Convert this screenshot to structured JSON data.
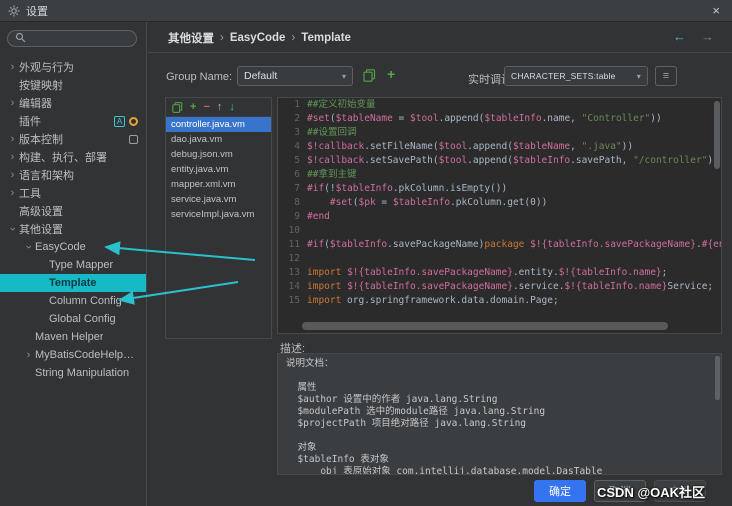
{
  "colors": {
    "accent_cyan": "#2bc0cd",
    "selection_blue": "#3874cb",
    "ok_blue": "#3574f0",
    "template_highlight": "#17b9c6"
  },
  "icons": {
    "close": "×",
    "back_arrow": "←",
    "forward_arrow": "→",
    "chevron": "›",
    "crumb_sep": "›",
    "dropdown_arrow": "▾",
    "add": "+",
    "remove": "−",
    "move_up": "↑",
    "move_down": "↓",
    "console": "≡"
  },
  "window": {
    "title": "设置"
  },
  "sidebar": {
    "items": [
      {
        "id": "appearance-behavior",
        "label": "外观与行为",
        "state": "collapsed",
        "level": 0
      },
      {
        "id": "keymap",
        "label": "按键映射",
        "state": "leaf",
        "level": 0
      },
      {
        "id": "editor",
        "label": "编辑器",
        "state": "collapsed",
        "level": 0
      },
      {
        "id": "plugins",
        "label": "插件",
        "state": "leaf",
        "level": 0,
        "badges": [
          {
            "name": "translation-plugin-icon",
            "glyph": "A",
            "style": "translate"
          },
          {
            "name": "plugin-gear-icon",
            "glyph": "",
            "style": "gear"
          }
        ]
      },
      {
        "id": "version-control",
        "label": "版本控制",
        "state": "collapsed",
        "level": 0,
        "badges": [
          {
            "name": "vcs-plugin-icon",
            "glyph": "",
            "style": "box"
          }
        ]
      },
      {
        "id": "build-execution-deployment",
        "label": "构建、执行、部署",
        "state": "collapsed",
        "level": 0
      },
      {
        "id": "languages-frameworks",
        "label": "语言和架构",
        "state": "collapsed",
        "level": 0
      },
      {
        "id": "tools",
        "label": "工具",
        "state": "collapsed",
        "level": 0
      },
      {
        "id": "advanced-settings",
        "label": "高级设置",
        "state": "leaf",
        "level": 0
      },
      {
        "id": "other-settings",
        "label": "其他设置",
        "state": "expanded",
        "level": 0
      },
      {
        "id": "easycode",
        "label": "EasyCode",
        "state": "expanded",
        "level": 1
      },
      {
        "id": "type-mapper",
        "label": "Type Mapper",
        "state": "leaf",
        "level": 2
      },
      {
        "id": "template",
        "label": "Template",
        "state": "leaf",
        "level": 2,
        "selected": true
      },
      {
        "id": "column-config",
        "label": "Column Config",
        "state": "leaf",
        "level": 2
      },
      {
        "id": "global-config",
        "label": "Global Config",
        "state": "leaf",
        "level": 2
      },
      {
        "id": "maven-helper",
        "label": "Maven Helper",
        "state": "leaf",
        "level": 1
      },
      {
        "id": "mybatiscodehelperpro",
        "label": "MyBatisCodeHelperPro",
        "state": "collapsed",
        "level": 1
      },
      {
        "id": "string-manipulation",
        "label": "String Manipulation",
        "state": "leaf",
        "level": 1
      }
    ]
  },
  "breadcrumb": {
    "parts": [
      "其他设置",
      "EasyCode",
      "Template"
    ]
  },
  "controls": {
    "group_name_label": "Group Name:",
    "group_name_value": "Default",
    "live_debug_label": "实时调试",
    "live_debug_value": "CHARACTER_SETS:table"
  },
  "template_list": {
    "selected_index": 0,
    "items": [
      "controller.java.vm",
      "dao.java.vm",
      "debug.json.vm",
      "entity.java.vm",
      "mapper.xml.vm",
      "service.java.vm",
      "serviceImpl.java.vm"
    ]
  },
  "editor": {
    "lines": [
      {
        "n": "1",
        "t": [
          [
            "c",
            "##定义初始变量"
          ]
        ]
      },
      {
        "n": "2",
        "t": [
          [
            "d",
            "#set"
          ],
          [
            "p",
            "("
          ],
          [
            "v",
            "$tableName"
          ],
          [
            "p",
            " = "
          ],
          [
            "v",
            "$tool"
          ],
          [
            "p",
            ".append("
          ],
          [
            "v",
            "$tableInfo"
          ],
          [
            "p",
            ".name, "
          ],
          [
            "s",
            "\"Controller\""
          ],
          [
            "p",
            "))"
          ]
        ]
      },
      {
        "n": "3",
        "t": [
          [
            "c",
            "##设置回调"
          ]
        ]
      },
      {
        "n": "4",
        "t": [
          [
            "v",
            "$!callback"
          ],
          [
            "p",
            ".setFileName("
          ],
          [
            "v",
            "$tool"
          ],
          [
            "p",
            ".append("
          ],
          [
            "v",
            "$tableName"
          ],
          [
            "p",
            ", "
          ],
          [
            "s",
            "\".java\""
          ],
          [
            "p",
            "))"
          ]
        ]
      },
      {
        "n": "5",
        "t": [
          [
            "v",
            "$!callback"
          ],
          [
            "p",
            ".setSavePath("
          ],
          [
            "v",
            "$tool"
          ],
          [
            "p",
            ".append("
          ],
          [
            "v",
            "$tableInfo"
          ],
          [
            "p",
            ".savePath, "
          ],
          [
            "s",
            "\"/controller\""
          ],
          [
            "p",
            "))"
          ]
        ]
      },
      {
        "n": "6",
        "t": [
          [
            "c",
            "##拿到主键"
          ]
        ]
      },
      {
        "n": "7",
        "t": [
          [
            "d",
            "#if"
          ],
          [
            "p",
            "(!"
          ],
          [
            "v",
            "$tableInfo"
          ],
          [
            "p",
            ".pkColumn.isEmpty())"
          ]
        ]
      },
      {
        "n": "8",
        "t": [
          [
            "p",
            "    "
          ],
          [
            "d",
            "#set"
          ],
          [
            "p",
            "("
          ],
          [
            "v",
            "$pk"
          ],
          [
            "p",
            " = "
          ],
          [
            "v",
            "$tableInfo"
          ],
          [
            "p",
            ".pkColumn.get(0))"
          ]
        ]
      },
      {
        "n": "9",
        "t": [
          [
            "d",
            "#end"
          ]
        ]
      },
      {
        "n": "10",
        "t": []
      },
      {
        "n": "11",
        "t": [
          [
            "d",
            "#if"
          ],
          [
            "p",
            "("
          ],
          [
            "v",
            "$tableInfo"
          ],
          [
            "p",
            ".savePackageName)"
          ],
          [
            "k",
            "package"
          ],
          [
            "p",
            " "
          ],
          [
            "v",
            "$!{tableInfo.savePackageName}"
          ],
          [
            "p",
            "."
          ],
          [
            "d",
            "#{end}"
          ],
          [
            "p",
            "controller;"
          ]
        ]
      },
      {
        "n": "12",
        "t": []
      },
      {
        "n": "13",
        "t": [
          [
            "k",
            "import"
          ],
          [
            "p",
            " "
          ],
          [
            "v",
            "$!{tableInfo.savePackageName}"
          ],
          [
            "p",
            ".entity."
          ],
          [
            "v",
            "$!{tableInfo.name}"
          ],
          [
            "p",
            ";"
          ]
        ]
      },
      {
        "n": "14",
        "t": [
          [
            "k",
            "import"
          ],
          [
            "p",
            " "
          ],
          [
            "v",
            "$!{tableInfo.savePackageName}"
          ],
          [
            "p",
            ".service."
          ],
          [
            "v",
            "$!{tableInfo.name}"
          ],
          [
            "p",
            "Service;"
          ]
        ]
      },
      {
        "n": "15",
        "t": [
          [
            "k",
            "import"
          ],
          [
            "p",
            " org.springframework.data.domain.Page;"
          ]
        ]
      }
    ]
  },
  "description": {
    "label": "描述:",
    "lines": [
      "说明文档：",
      "",
      "  属性",
      "  $author 设置中的作者 java.lang.String",
      "  $modulePath 选中的module路径 java.lang.String",
      "  $projectPath 项目绝对路径 java.lang.String",
      "",
      "  对象",
      "  $tableInfo 表对象",
      "      obj 表原始对象 com.intellij.database.model.DasTable"
    ]
  },
  "footer": {
    "ok": "确定",
    "cancel": "取消",
    "apply": "应用"
  },
  "watermark": "CSDN @OAK社区"
}
